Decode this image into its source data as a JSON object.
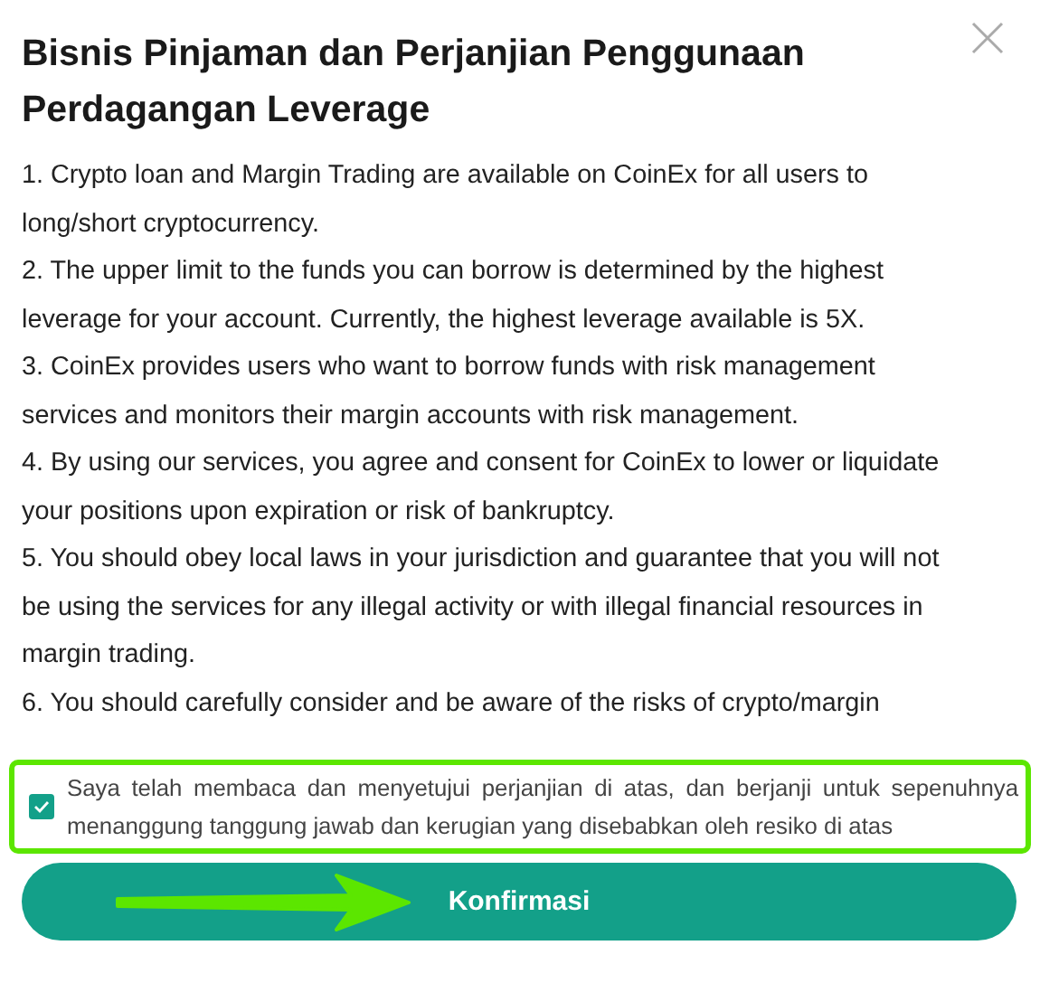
{
  "dialog": {
    "title": "Bisnis Pinjaman dan Perjanjian Penggunaan Perdagangan Leverage",
    "terms": [
      "1. Crypto loan and Margin Trading are available on CoinEx for all users to long/short cryptocurrency.",
      "2. The upper limit to the funds you can borrow is determined by the highest leverage for your account. Currently, the highest leverage available is 5X.",
      "3. CoinEx provides users who want to borrow funds with risk management services and monitors their margin accounts with risk management.",
      "4. By using our services, you agree and consent for CoinEx to lower or liquidate your positions upon expiration or risk of bankruptcy.",
      "5. You should obey local laws in your jurisdiction and guarantee that you will not be using the services for any illegal activity or with illegal financial resources in margin trading.",
      "6. You should carefully consider and be aware of the risks of crypto/margin"
    ],
    "agreement": {
      "label": "Saya telah membaca dan menyetujui perjanjian di atas, dan berjanji untuk sepenuhnya menanggung tanggung jawab dan kerugian yang disebabkan oleh resiko di atas",
      "checked": true
    },
    "confirm_button": "Konfirmasi"
  }
}
